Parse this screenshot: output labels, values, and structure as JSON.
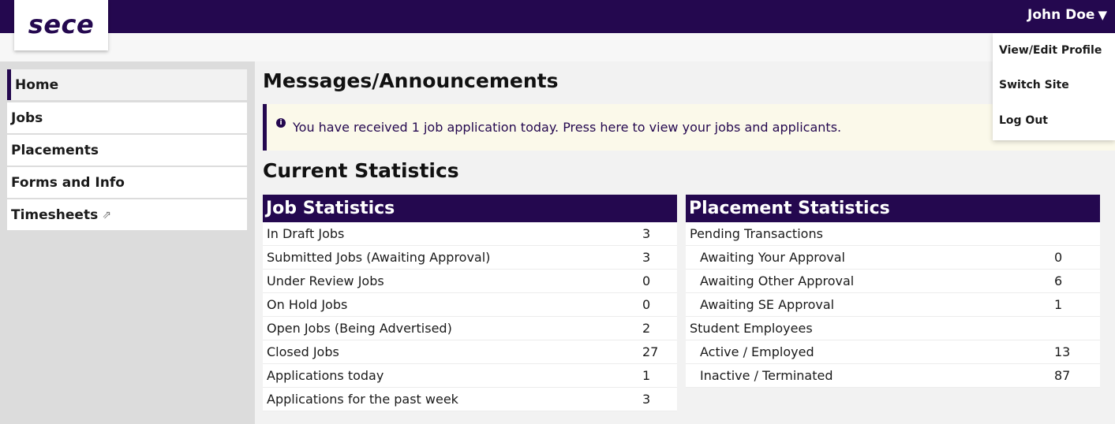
{
  "header": {
    "logo_text": "sece",
    "user_name": "John Doe",
    "user_caret": "▼"
  },
  "user_dropdown": {
    "items": [
      "View/Edit Profile",
      "Switch Site",
      "Log Out"
    ]
  },
  "sidebar": {
    "items": [
      {
        "label": "Home"
      },
      {
        "label": "Jobs"
      },
      {
        "label": "Placements"
      },
      {
        "label": "Forms and Info"
      },
      {
        "label": "Timesheets",
        "icon": "⇗"
      }
    ]
  },
  "main": {
    "messages_title": "Messages/Announcements",
    "announcement": "You have received 1 job application today. Press here to view your jobs and applicants.",
    "info_icon": "i",
    "stats_title": "Current Statistics"
  },
  "job_stats": {
    "title": "Job Statistics",
    "rows": [
      {
        "label": "In Draft Jobs",
        "value": "3"
      },
      {
        "label": "Submitted Jobs (Awaiting Approval)",
        "value": "3"
      },
      {
        "label": "Under Review Jobs",
        "value": "0"
      },
      {
        "label": "On Hold Jobs",
        "value": "0"
      },
      {
        "label": "Open Jobs (Being Advertised)",
        "value": "2"
      },
      {
        "label": "Closed Jobs",
        "value": "27"
      },
      {
        "label": "Applications today",
        "value": "1"
      },
      {
        "label": "Applications for the past week",
        "value": "3"
      }
    ]
  },
  "placement_stats": {
    "title": "Placement Statistics",
    "rows": [
      {
        "label": "Pending Transactions",
        "value": ""
      },
      {
        "label": "Awaiting Your Approval",
        "value": "0"
      },
      {
        "label": "Awaiting Other Approval",
        "value": "6"
      },
      {
        "label": "Awaiting SE Approval",
        "value": "1"
      },
      {
        "label": "Student Employees",
        "value": ""
      },
      {
        "label": "Active / Employed",
        "value": "13"
      },
      {
        "label": "Inactive / Terminated",
        "value": "87"
      }
    ]
  },
  "colors": {
    "brand": "#24084f",
    "announcement_bg": "#fbf9ea",
    "sidebar_bg": "#dcdcdc"
  }
}
